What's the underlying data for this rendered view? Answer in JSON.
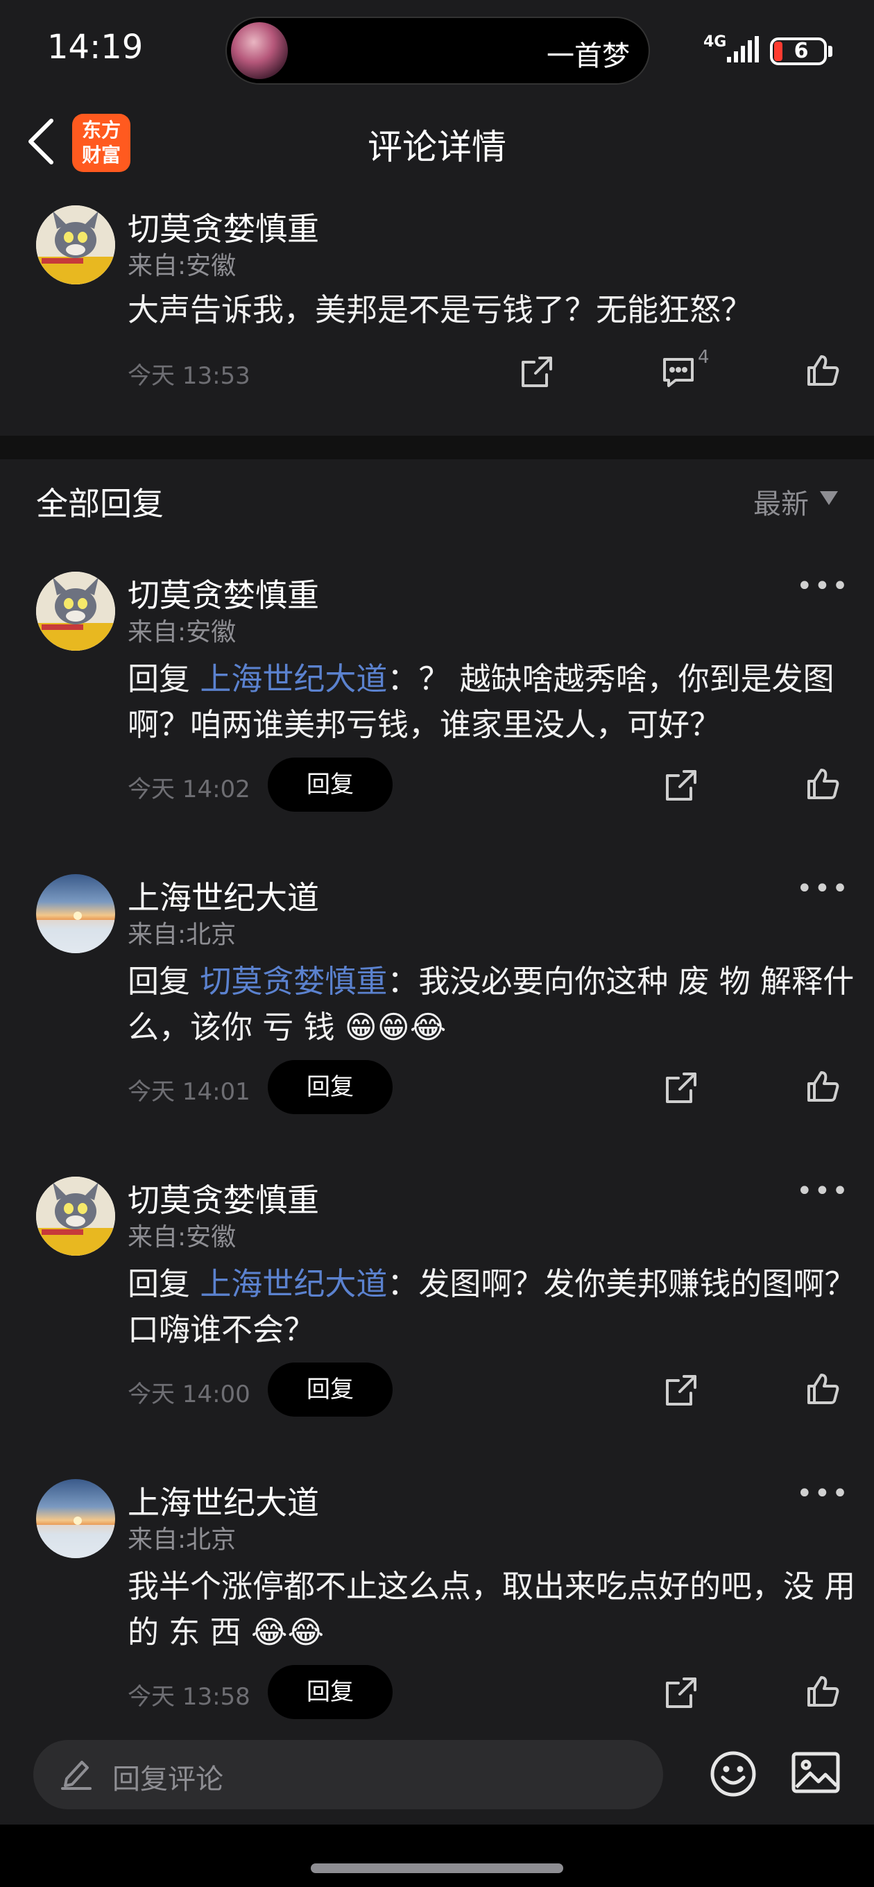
{
  "status_bar": {
    "time": "14:19",
    "now_playing": "一首梦",
    "network": "4G",
    "battery": "6"
  },
  "nav": {
    "title": "评论详情",
    "logo_line1": "东方",
    "logo_line2": "财富"
  },
  "main_comment": {
    "user": "切莫贪婪慎重",
    "location": "来自:安徽",
    "text": "大声告诉我，美邦是不是亏钱了？无能狂怒？",
    "time": "今天 13:53",
    "comment_count": "4"
  },
  "replies_header": {
    "title": "全部回复",
    "sort": "最新"
  },
  "replies": [
    {
      "user": "切莫贪婪慎重",
      "location": "来自:安徽",
      "reply_prefix": " 回复 ",
      "mention": "上海世纪大道",
      "body": "：？ 越缺啥越秀啥，你到是发图啊？咱两谁美邦亏钱，谁家里没人，可好？",
      "time": "今天 14:02",
      "reply_label": "回复"
    },
    {
      "user": "上海世纪大道",
      "location": "来自:北京",
      "reply_prefix": " 回复 ",
      "mention": "切莫贪婪慎重",
      "body": "：我没必要向你这种 废 物 解释什么，该你 亏 钱 😁😁😂",
      "time": "今天 14:01",
      "reply_label": "回复"
    },
    {
      "user": "切莫贪婪慎重",
      "location": "来自:安徽",
      "reply_prefix": " 回复 ",
      "mention": "上海世纪大道",
      "body": "：发图啊？发你美邦赚钱的图啊？口嗨谁不会？",
      "time": "今天 14:00",
      "reply_label": "回复"
    },
    {
      "user": "上海世纪大道",
      "location": "来自:北京",
      "reply_prefix": "",
      "mention": "",
      "body": "我半个涨停都不止这么点，取出来吃点好的吧，没 用 的 东 西 😂😂",
      "time": "今天 13:58",
      "reply_label": "回复"
    }
  ],
  "bottom_bar": {
    "input_placeholder": "回复评论"
  },
  "icons": {
    "back": "chevron-left-icon",
    "share": "share-icon",
    "comment": "comment-icon",
    "like": "thumbs-up-icon",
    "more": "more-icon",
    "pen": "pen-icon",
    "emoji": "smile-icon",
    "image": "image-icon"
  },
  "colors": {
    "background": "#1c1c1e",
    "mention": "#5b82cf",
    "logo": "#ff5a1f",
    "battery_low": "#ff3b30"
  }
}
